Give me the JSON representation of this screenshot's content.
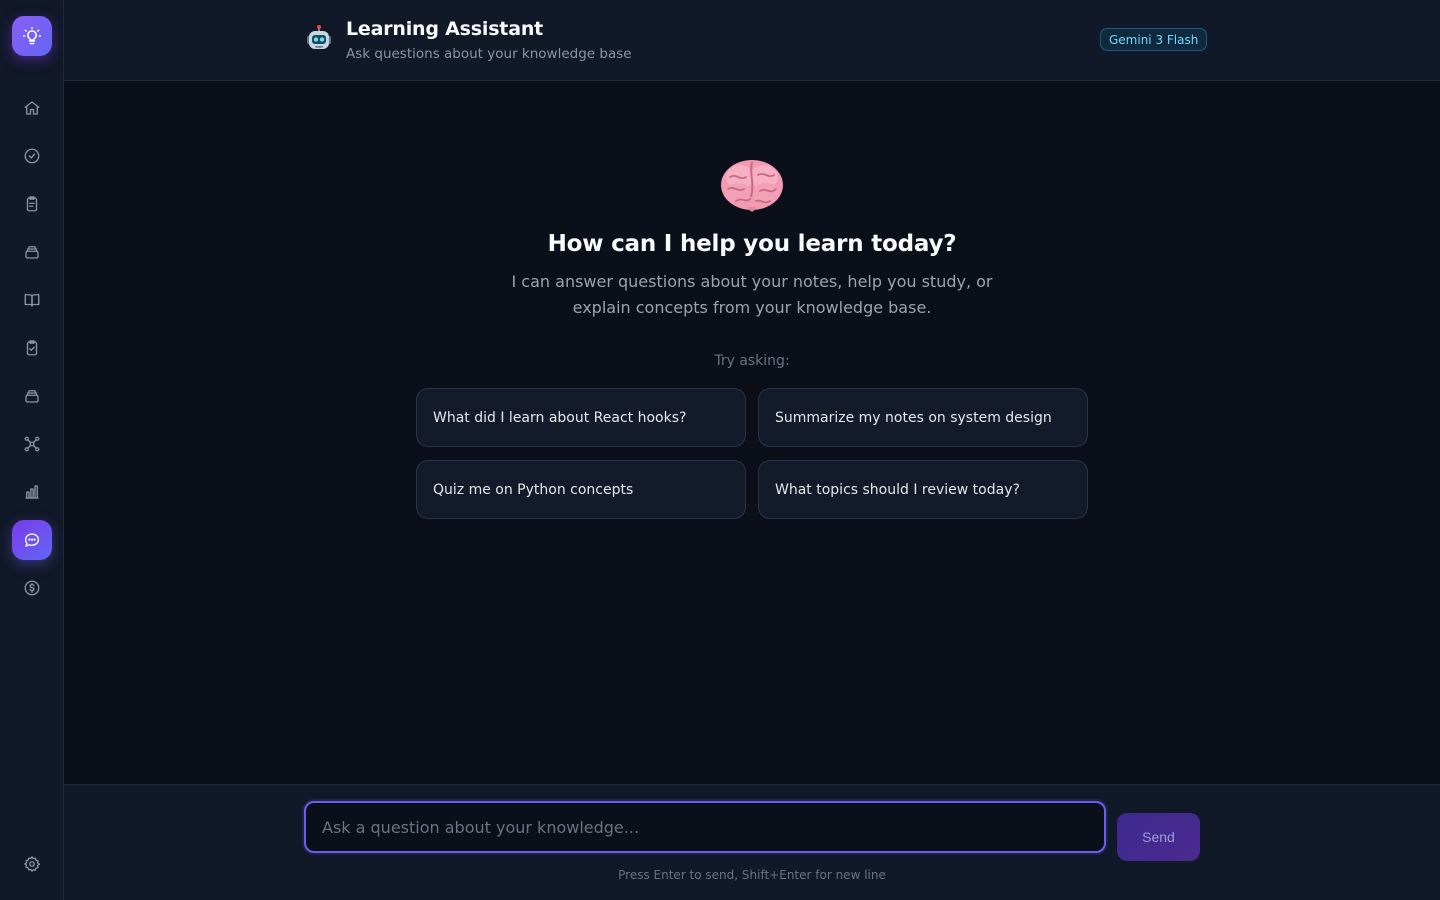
{
  "header": {
    "title": "Learning Assistant",
    "subtitle": "Ask questions about your knowledge base",
    "model_badge": "Gemini 3 Flash"
  },
  "sidebar": {
    "items": [
      {
        "icon": "home-icon"
      },
      {
        "icon": "check-circle-icon"
      },
      {
        "icon": "clipboard-icon"
      },
      {
        "icon": "inbox-icon"
      },
      {
        "icon": "book-open-icon"
      },
      {
        "icon": "clipboard-check-icon"
      },
      {
        "icon": "archive-icon"
      },
      {
        "icon": "network-icon"
      },
      {
        "icon": "bar-chart-icon"
      },
      {
        "icon": "chat-icon",
        "active": true
      },
      {
        "icon": "dollar-icon"
      },
      {
        "icon": "settings-icon"
      }
    ]
  },
  "hero": {
    "title": "How can I help you learn today?",
    "text": "I can answer questions about your notes, help you study, or explain concepts from your knowledge base.",
    "try_label": "Try asking:"
  },
  "suggestions": [
    "What did I learn about React hooks?",
    "Summarize my notes on system design",
    "Quiz me on Python concepts",
    "What topics should I review today?"
  ],
  "composer": {
    "placeholder": "Ask a question about your knowledge...",
    "value": "",
    "send_label": "Send",
    "hint": "Press Enter to send, Shift+Enter for new line"
  },
  "colors": {
    "accent": "#7c3aed",
    "background": "#0a0f1a",
    "panel": "#111827",
    "badge_text": "#7dd3fc"
  }
}
